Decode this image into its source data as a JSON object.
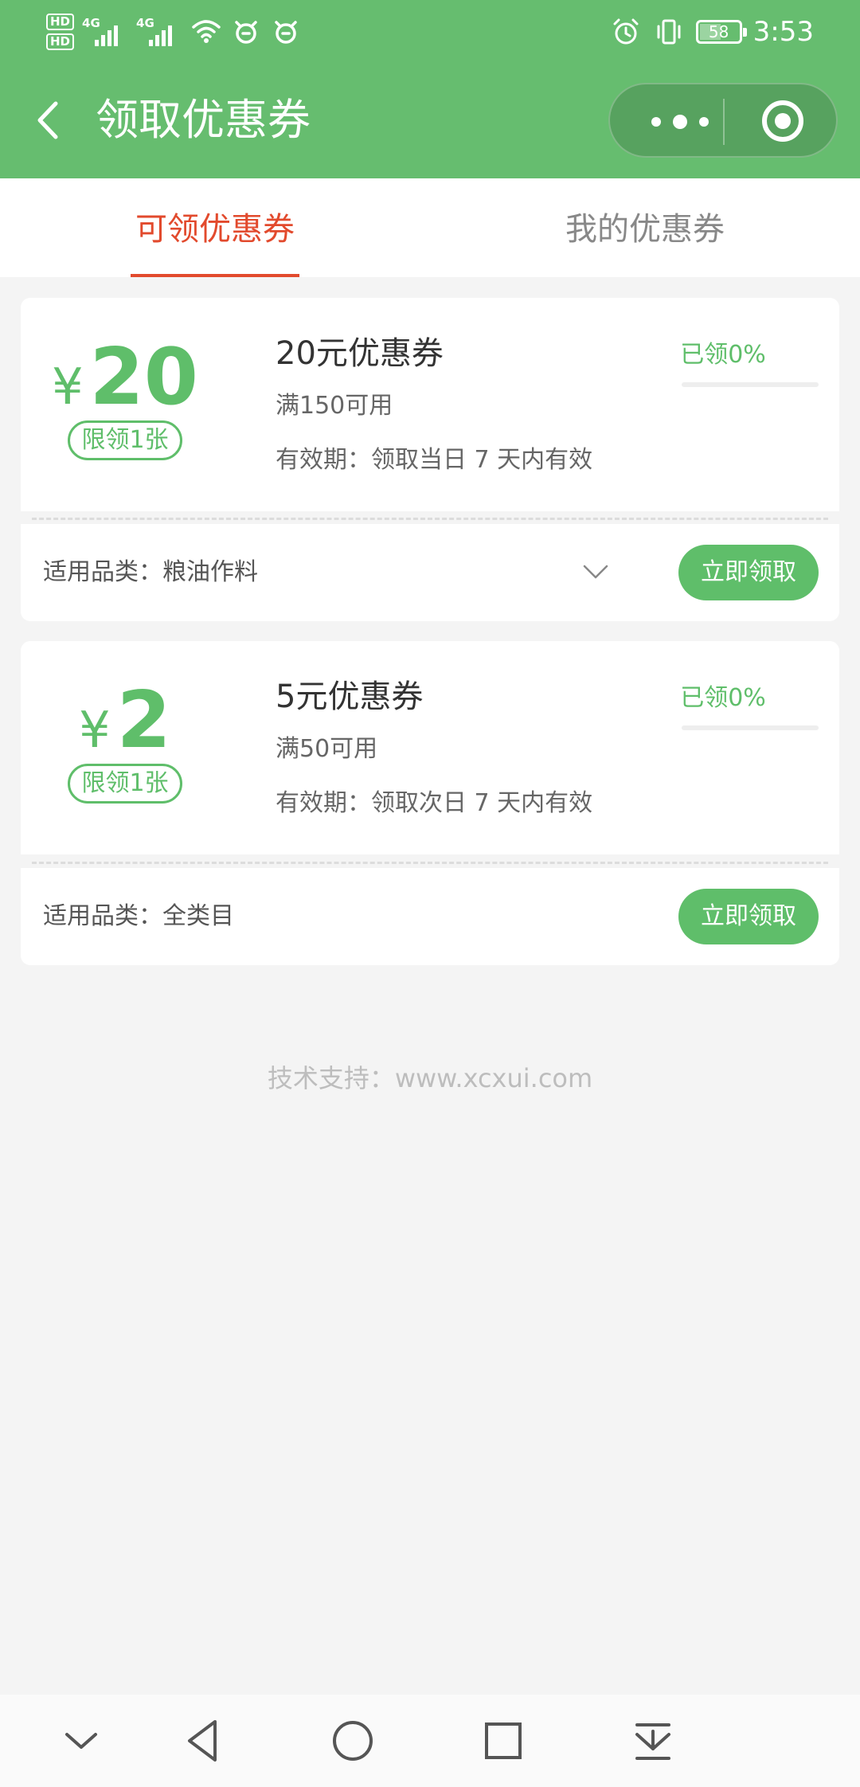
{
  "colors": {
    "header_bg": "#66bd6f",
    "accent_green": "#5fbe6a",
    "tab_active": "#e24a2d",
    "page_bg": "#f4f4f4"
  },
  "status_bar": {
    "sim1_label": "HD",
    "sim2_label": "HD",
    "net1": "4G",
    "net2": "4G",
    "battery": "58",
    "battery_level": 0.58,
    "time": "3:53",
    "icons": [
      "signal-icon",
      "wifi-icon",
      "notification-icon",
      "alarm-icon",
      "vibrate-icon",
      "battery-icon"
    ]
  },
  "header": {
    "title": "领取优惠券",
    "back_icon": "chevron-left-icon",
    "more_icon": "more-dots-icon",
    "close_icon": "target-circle-icon"
  },
  "tabs": [
    {
      "label": "可领优惠券",
      "active": true
    },
    {
      "label": "我的优惠券",
      "active": false
    }
  ],
  "coupons": [
    {
      "currency": "¥",
      "amount": "20",
      "limit": "限领1张",
      "title": "20元优惠券",
      "condition": "满150可用",
      "validity": "有效期：领取当日 7 天内有效",
      "claimed": "已领0%",
      "claimed_fraction": 0,
      "category": "适用品类：粮油作料",
      "has_expand": true,
      "button": "立即领取"
    },
    {
      "currency": "¥",
      "amount": "2",
      "limit": "限领1张",
      "title": "5元优惠券",
      "condition": "满50可用",
      "validity": "有效期：领取次日 7 天内有效",
      "claimed": "已领0%",
      "claimed_fraction": 0,
      "category": "适用品类：全类目",
      "has_expand": false,
      "button": "立即领取"
    }
  ],
  "footer": {
    "support": "技术支持：www.xcxui.com"
  },
  "nav_bar": {
    "icons": [
      "collapse-down-icon",
      "back-triangle-icon",
      "home-circle-icon",
      "recents-square-icon",
      "download-icon"
    ]
  }
}
